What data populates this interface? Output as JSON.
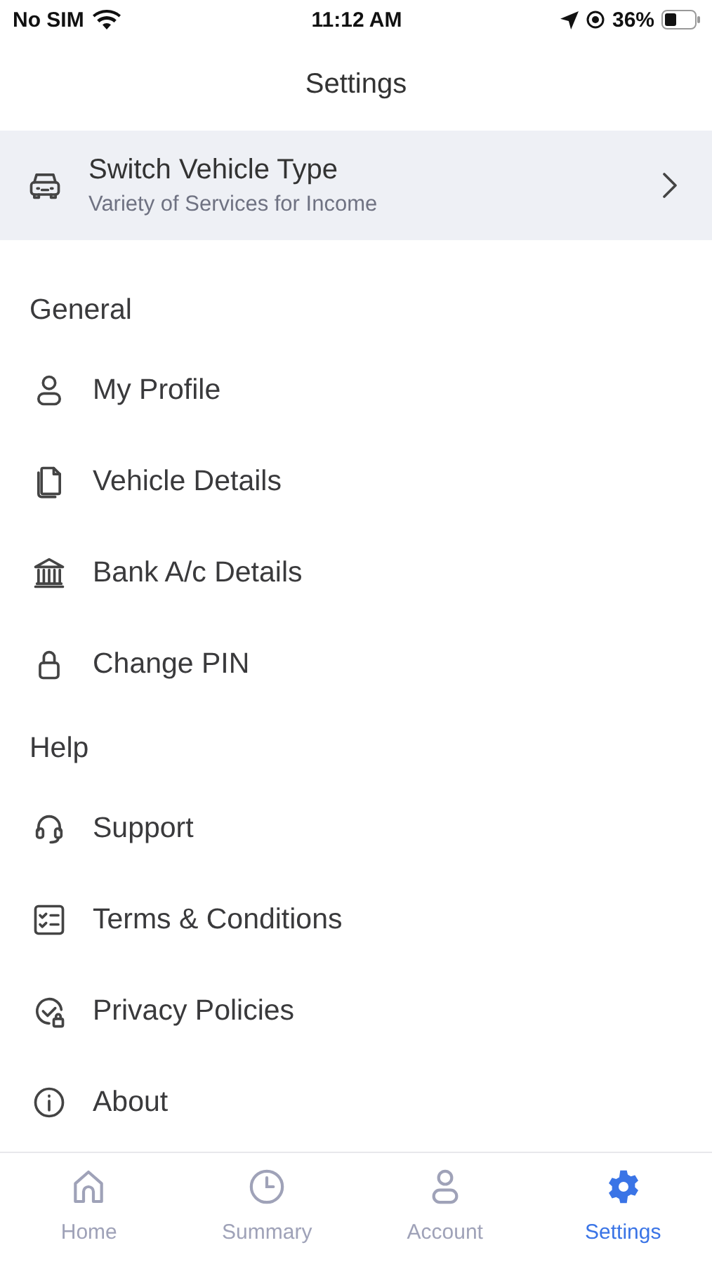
{
  "status_bar": {
    "carrier": "No SIM",
    "time": "11:12 AM",
    "battery": "36%"
  },
  "header": {
    "title": "Settings"
  },
  "vehicle_banner": {
    "title": "Switch Vehicle Type",
    "subtitle": "Variety of Services for Income"
  },
  "sections": [
    {
      "heading": "General",
      "items": [
        {
          "label": "My Profile"
        },
        {
          "label": "Vehicle Details"
        },
        {
          "label": "Bank A/c Details"
        },
        {
          "label": "Change PIN"
        }
      ]
    },
    {
      "heading": "Help",
      "items": [
        {
          "label": "Support"
        },
        {
          "label": "Terms & Conditions"
        },
        {
          "label": "Privacy Policies"
        },
        {
          "label": "About"
        }
      ]
    }
  ],
  "tab_bar": [
    {
      "label": "Home",
      "selected": false
    },
    {
      "label": "Summary",
      "selected": false
    },
    {
      "label": "Account",
      "selected": false
    },
    {
      "label": "Settings",
      "selected": true
    }
  ]
}
